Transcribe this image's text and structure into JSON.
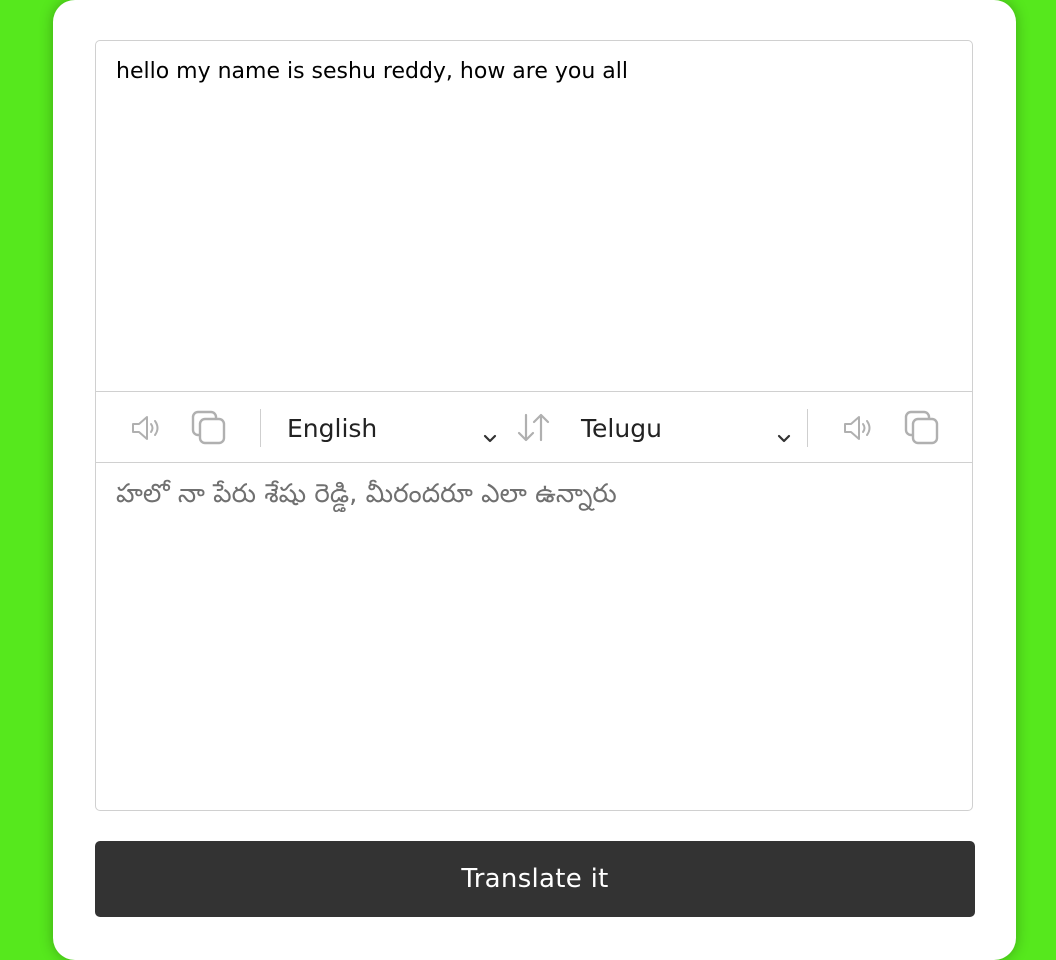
{
  "from_text": "hello my name is seshu reddy, how are you all",
  "to_text": "హలో నా పేరు శేషు రెడ్డి, మీరందరూ ఎలా ఉన్నారు",
  "controls": {
    "from_language": "English",
    "to_language": "Telugu"
  },
  "button": {
    "label": "Translate it"
  },
  "colors": {
    "background": "#56e81d",
    "card": "#ffffff",
    "button": "#333333",
    "icon": "#b0b0b0"
  },
  "icons": [
    "volume-icon",
    "copy-icon",
    "chevron-down-icon",
    "swap-icon"
  ]
}
